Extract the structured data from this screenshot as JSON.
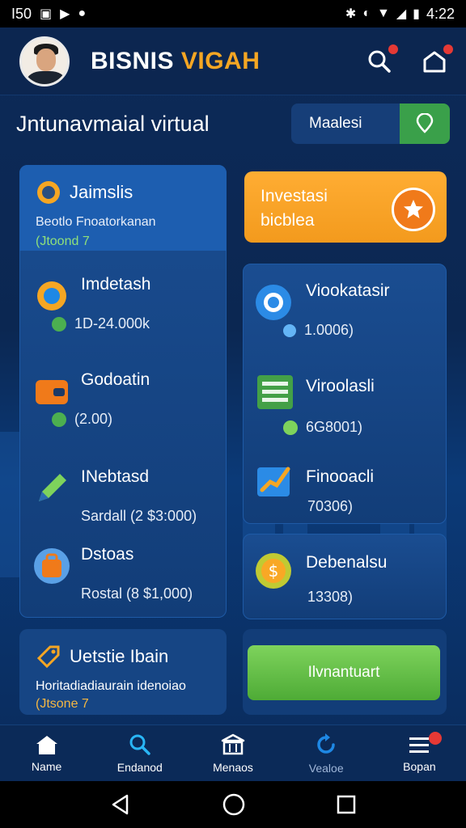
{
  "status_bar": {
    "left_text": "I50",
    "time": "4:22"
  },
  "header": {
    "brand_part1": "BISNIS",
    "brand_part2": "VIGAH"
  },
  "title_bar": {
    "title": "Jntunavmaial virtual",
    "action_label": "Maalesi"
  },
  "left_featured": {
    "title": "Jaimslis",
    "subtitle": "Beotlo Fnoatorkanan",
    "tag": "(Jtoond 7"
  },
  "left_items": [
    {
      "title": "Imdetash",
      "value": "1D-24.000k"
    },
    {
      "title": "Godoatin",
      "value": "(2.00)"
    },
    {
      "title": "INebtasd",
      "value": "Sardall (2  $3:000)"
    },
    {
      "title": "Dstoas",
      "value": "Rostal (8  $1,000)"
    }
  ],
  "invest_card": {
    "line1": "Investasi",
    "line2": "bicblea"
  },
  "right_items": [
    {
      "title": "Viookatasir",
      "value": "1.0006)"
    },
    {
      "title": "Viroolasli",
      "value": "6G8001)"
    },
    {
      "title": "Finooacli",
      "value": "70306)"
    },
    {
      "title": "Debenalsu",
      "value": "13308)"
    }
  ],
  "bottom_left": {
    "title": "Uetstie Ibain",
    "subtitle": "Horitadiadiaurain idenoiao",
    "tag": "(Jtsone 7"
  },
  "primary_button": "Ilvnantuart",
  "bottom_nav": [
    {
      "label": "Name"
    },
    {
      "label": "Endanod"
    },
    {
      "label": "Menaos"
    },
    {
      "label": "Vealoe"
    },
    {
      "label": "Bopan"
    }
  ],
  "colors": {
    "accent_orange": "#f5a623",
    "accent_green": "#4eab36",
    "background": "#0b2752"
  }
}
